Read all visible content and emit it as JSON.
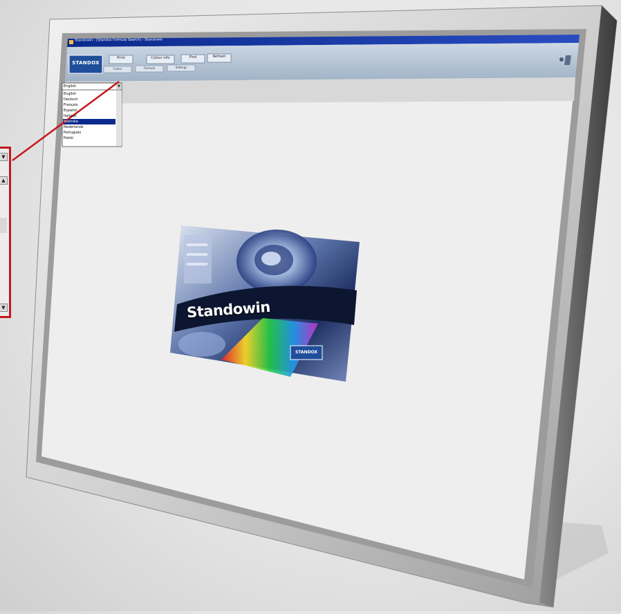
{
  "brand": {
    "name": "STANDOX",
    "color": "#1f4f9a"
  },
  "window": {
    "title": "Standowin - [Standox Formula Search] - Standowin"
  },
  "toolbar": {
    "buttons": [
      "Print",
      "Colour info",
      "Find",
      "Refresh"
    ],
    "sub_buttons": [
      "Colour",
      "Formula",
      "Settings"
    ]
  },
  "language_dropdown": {
    "selected": "English",
    "options": [
      "English",
      "Deutsch",
      "Français",
      "Español",
      "Italiano",
      "Svenska",
      "Nederlands",
      "Português",
      "Polski"
    ],
    "highlighted_index": 5
  },
  "splash": {
    "title": "Standowin",
    "logo": "STANDOX"
  },
  "colors": {
    "accent": "#c4161c",
    "title_bar": "#0a2a8c",
    "toolbar": "#b9c8d8"
  }
}
